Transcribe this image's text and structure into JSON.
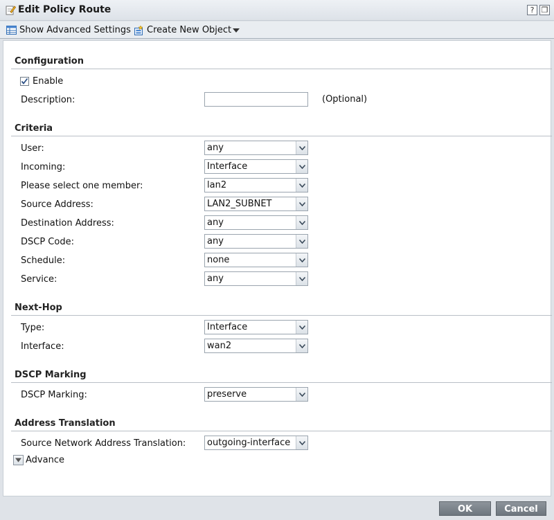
{
  "window": {
    "title": "Edit Policy Route",
    "help_label": "?",
    "restore_label": "❒"
  },
  "toolbar": {
    "show_advanced": "Show Advanced Settings",
    "create_object": "Create New Object"
  },
  "configuration": {
    "title": "Configuration",
    "enable_label": "Enable",
    "enable_checked": true,
    "description_label": "Description:",
    "description_value": "",
    "optional_label": "(Optional)"
  },
  "criteria": {
    "title": "Criteria",
    "fields": [
      {
        "label": "User:",
        "value": "any"
      },
      {
        "label": "Incoming:",
        "value": "Interface"
      },
      {
        "label": "Please select one member:",
        "value": "lan2"
      },
      {
        "label": "Source Address:",
        "value": "LAN2_SUBNET"
      },
      {
        "label": "Destination Address:",
        "value": "any"
      },
      {
        "label": "DSCP Code:",
        "value": "any"
      },
      {
        "label": "Schedule:",
        "value": "none"
      },
      {
        "label": "Service:",
        "value": "any"
      }
    ]
  },
  "nexthop": {
    "title": "Next-Hop",
    "fields": [
      {
        "label": "Type:",
        "value": "Interface"
      },
      {
        "label": "Interface:",
        "value": "wan2"
      }
    ]
  },
  "dscp": {
    "title": "DSCP Marking",
    "fields": [
      {
        "label": "DSCP Marking:",
        "value": "preserve"
      }
    ]
  },
  "nat": {
    "title": "Address Translation",
    "fields": [
      {
        "label": "Source Network Address Translation:",
        "value": "outgoing-interface"
      }
    ]
  },
  "advance_label": "Advance",
  "footer": {
    "ok": "OK",
    "cancel": "Cancel"
  }
}
